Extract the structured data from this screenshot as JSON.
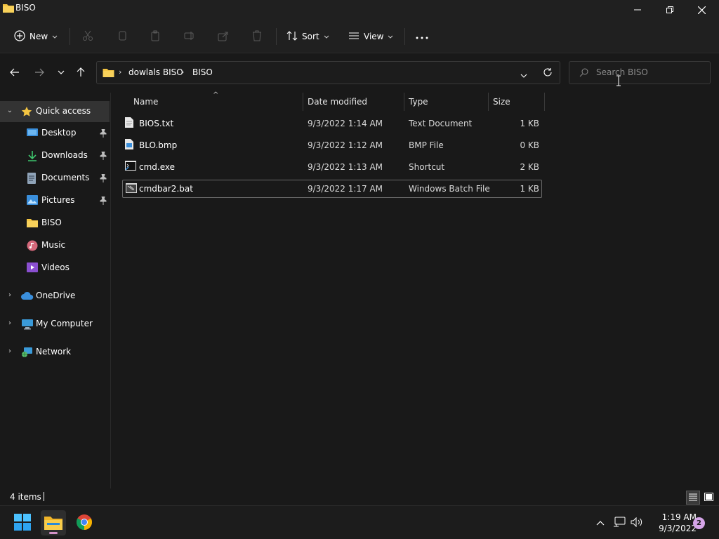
{
  "window": {
    "title": "BISO"
  },
  "toolbar": {
    "new_label": "New",
    "sort_label": "Sort",
    "view_label": "View",
    "more_label": "···"
  },
  "address": {
    "crumbs": [
      "dowlals BISO",
      "BISO"
    ],
    "search_placeholder": "Search BISO"
  },
  "sidebar": {
    "items": [
      {
        "label": "Quick access",
        "icon": "star-icon"
      },
      {
        "label": "Desktop",
        "icon": "desktop-icon"
      },
      {
        "label": "Downloads",
        "icon": "download-icon"
      },
      {
        "label": "Documents",
        "icon": "documents-icon"
      },
      {
        "label": "Pictures",
        "icon": "pictures-icon"
      },
      {
        "label": "BISO",
        "icon": "folder-icon"
      },
      {
        "label": "Music",
        "icon": "music-icon"
      },
      {
        "label": "Videos",
        "icon": "videos-icon"
      },
      {
        "label": "OneDrive",
        "icon": "cloud-icon"
      },
      {
        "label": "My Computer",
        "icon": "computer-icon"
      },
      {
        "label": "Network",
        "icon": "network-icon"
      }
    ]
  },
  "files": {
    "columns": [
      "Name",
      "Date modified",
      "Type",
      "Size"
    ],
    "rows": [
      {
        "name": "BIOS.txt",
        "date": "9/3/2022 1:14 AM",
        "type": "Text Document",
        "size": "1 KB"
      },
      {
        "name": "BLO.bmp",
        "date": "9/3/2022 1:12 AM",
        "type": "BMP File",
        "size": "0 KB"
      },
      {
        "name": "cmd.exe",
        "date": "9/3/2022 1:13 AM",
        "type": "Shortcut",
        "size": "2 KB"
      },
      {
        "name": "cmdbar2.bat",
        "date": "9/3/2022 1:17 AM",
        "type": "Windows Batch File",
        "size": "1 KB"
      }
    ]
  },
  "status": {
    "item_count": "4 items"
  },
  "taskbar": {
    "time": "1:19 AM",
    "date": "9/3/2022",
    "notifications": "2"
  },
  "colors": {
    "background": "#191919",
    "chrome": "#202020",
    "folder": "#f4c542",
    "accent": "#d492c8"
  }
}
